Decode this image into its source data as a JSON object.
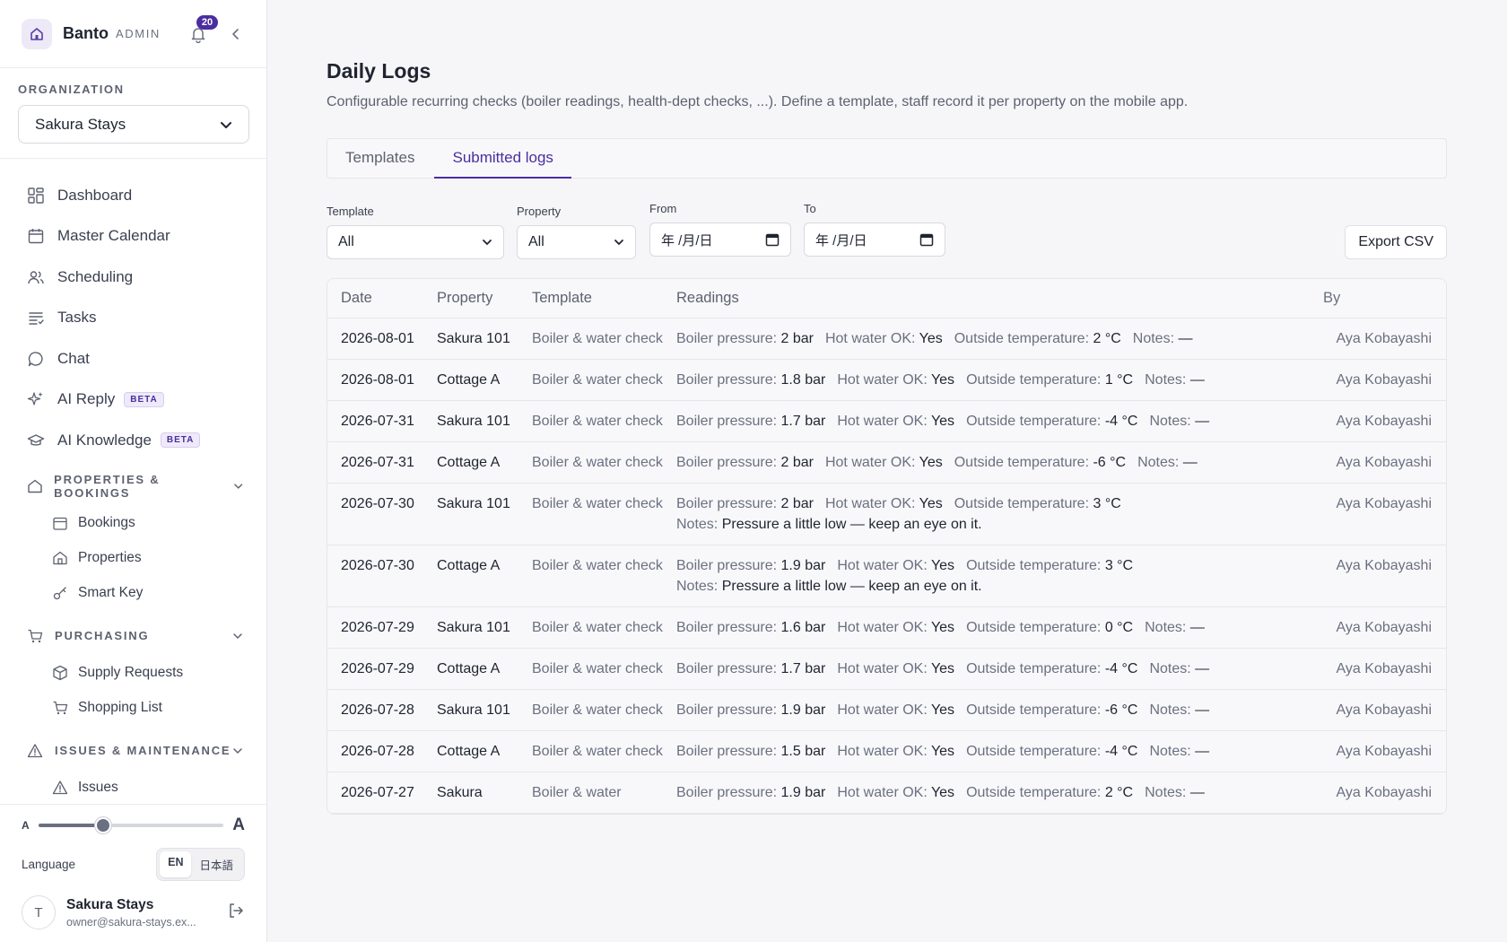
{
  "app": {
    "name": "Banto",
    "tag": "ADMIN",
    "notification_count": "20"
  },
  "organization": {
    "label": "ORGANIZATION",
    "selected": "Sakura Stays"
  },
  "nav": [
    {
      "label": "Dashboard",
      "icon": "dashboard-icon"
    },
    {
      "label": "Master Calendar",
      "icon": "calendar-icon"
    },
    {
      "label": "Scheduling",
      "icon": "users-icon"
    },
    {
      "label": "Tasks",
      "icon": "tasks-icon"
    },
    {
      "label": "Chat",
      "icon": "chat-icon"
    },
    {
      "label": "AI Reply",
      "icon": "sparkle-icon",
      "badge": "BETA"
    },
    {
      "label": "AI Knowledge",
      "icon": "graduation-cap-icon",
      "badge": "BETA"
    }
  ],
  "sections": {
    "properties": {
      "label": "PROPERTIES & BOOKINGS",
      "items": [
        "Bookings",
        "Properties",
        "Smart Key"
      ]
    },
    "purchasing": {
      "label": "PURCHASING",
      "items": [
        "Supply Requests",
        "Shopping List"
      ]
    },
    "issues": {
      "label": "ISSUES & MAINTENANCE",
      "items": [
        "Issues"
      ]
    }
  },
  "text_size": {
    "small_label": "A",
    "large_label": "A",
    "level": 0.35
  },
  "language": {
    "label": "Language",
    "options": [
      "EN",
      "日本語"
    ],
    "selected": "EN"
  },
  "user": {
    "initial": "T",
    "name": "Sakura Stays",
    "email": "owner@sakura-stays.ex..."
  },
  "page": {
    "title": "Daily Logs",
    "description": "Configurable recurring checks (boiler readings, health-dept checks, ...). Define a template, staff record it per property on the mobile app."
  },
  "tabs": [
    "Templates",
    "Submitted logs"
  ],
  "active_tab": "Submitted logs",
  "filters": {
    "template": {
      "label": "Template",
      "value": "All"
    },
    "property": {
      "label": "Property",
      "value": "All"
    },
    "from": {
      "label": "From",
      "value": "年 /月/日"
    },
    "to": {
      "label": "To",
      "value": "年 /月/日"
    },
    "export_label": "Export CSV"
  },
  "table": {
    "columns": [
      "Date",
      "Property",
      "Template",
      "Readings",
      "By"
    ],
    "reading_labels": {
      "pressure": "Boiler pressure:",
      "hotwater": "Hot water OK:",
      "temp": "Outside temperature:",
      "notes": "Notes:"
    },
    "rows": [
      {
        "date": "2026-08-01",
        "property": "Sakura 101",
        "template": "Boiler & water check",
        "pressure": "2 bar",
        "hotwater": "Yes",
        "temp": "2 °C",
        "notes": "—",
        "by": "Aya Kobayashi"
      },
      {
        "date": "2026-08-01",
        "property": "Cottage A",
        "template": "Boiler & water check",
        "pressure": "1.8 bar",
        "hotwater": "Yes",
        "temp": "1 °C",
        "notes": "—",
        "by": "Aya Kobayashi"
      },
      {
        "date": "2026-07-31",
        "property": "Sakura 101",
        "template": "Boiler & water check",
        "pressure": "1.7 bar",
        "hotwater": "Yes",
        "temp": "-4 °C",
        "notes": "—",
        "by": "Aya Kobayashi"
      },
      {
        "date": "2026-07-31",
        "property": "Cottage A",
        "template": "Boiler & water check",
        "pressure": "2 bar",
        "hotwater": "Yes",
        "temp": "-6 °C",
        "notes": "—",
        "by": "Aya Kobayashi"
      },
      {
        "date": "2026-07-30",
        "property": "Sakura 101",
        "template": "Boiler & water check",
        "pressure": "2 bar",
        "hotwater": "Yes",
        "temp": "3 °C",
        "notes": "Pressure a little low — keep an eye on it.",
        "notes_wrap": true,
        "by": "Aya Kobayashi"
      },
      {
        "date": "2026-07-30",
        "property": "Cottage A",
        "template": "Boiler & water check",
        "pressure": "1.9 bar",
        "hotwater": "Yes",
        "temp": "3 °C",
        "notes": "Pressure a little low — keep an eye on it.",
        "notes_wrap": true,
        "by": "Aya Kobayashi"
      },
      {
        "date": "2026-07-29",
        "property": "Sakura 101",
        "template": "Boiler & water check",
        "pressure": "1.6 bar",
        "hotwater": "Yes",
        "temp": "0 °C",
        "notes": "—",
        "by": "Aya Kobayashi"
      },
      {
        "date": "2026-07-29",
        "property": "Cottage A",
        "template": "Boiler & water check",
        "pressure": "1.7 bar",
        "hotwater": "Yes",
        "temp": "-4 °C",
        "notes": "—",
        "by": "Aya Kobayashi"
      },
      {
        "date": "2026-07-28",
        "property": "Sakura 101",
        "template": "Boiler & water check",
        "pressure": "1.9 bar",
        "hotwater": "Yes",
        "temp": "-6 °C",
        "notes": "—",
        "by": "Aya Kobayashi"
      },
      {
        "date": "2026-07-28",
        "property": "Cottage A",
        "template": "Boiler & water check",
        "pressure": "1.5 bar",
        "hotwater": "Yes",
        "temp": "-4 °C",
        "notes": "—",
        "by": "Aya Kobayashi"
      },
      {
        "date": "2026-07-27",
        "property": "Sakura",
        "template": "Boiler & water",
        "pressure": "1.9 bar",
        "hotwater": "Yes",
        "temp": "2 °C",
        "notes": "—",
        "by": "Aya Kobayashi"
      }
    ]
  },
  "colors": {
    "accent": "#4a2ea0",
    "border": "#e6e6ea",
    "muted": "#6b7080"
  }
}
